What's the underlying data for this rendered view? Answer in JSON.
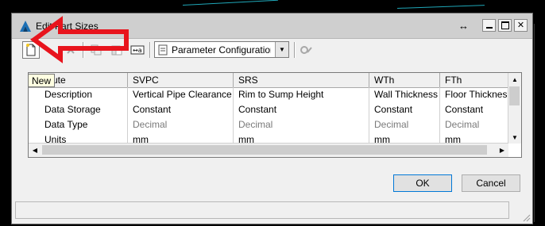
{
  "window": {
    "title": "Edit Part Sizes"
  },
  "toolbar": {
    "new_tooltip": "New",
    "parameter_combo": "Parameter Configuration"
  },
  "grid": {
    "columns": [
      "ute",
      "SVPC",
      "SRS",
      "WTh",
      "FTh"
    ],
    "rows": [
      {
        "cells": [
          "Description",
          "Vertical Pipe Clearance",
          "Rim to Sump Height",
          "Wall Thickness",
          "Floor Thicknes"
        ]
      },
      {
        "cells": [
          "Data Storage",
          "Constant",
          "Constant",
          "Constant",
          "Constant"
        ]
      },
      {
        "cells": [
          "Data Type",
          "Decimal",
          "Decimal",
          "Decimal",
          "Decimal"
        ]
      },
      {
        "cells": [
          "Units",
          "mm",
          "mm",
          "mm",
          "mm"
        ]
      }
    ]
  },
  "buttons": {
    "ok": "OK",
    "cancel": "Cancel"
  },
  "colors": {
    "annotation": "#e8141d",
    "background_lines": "#1fa7b8"
  }
}
